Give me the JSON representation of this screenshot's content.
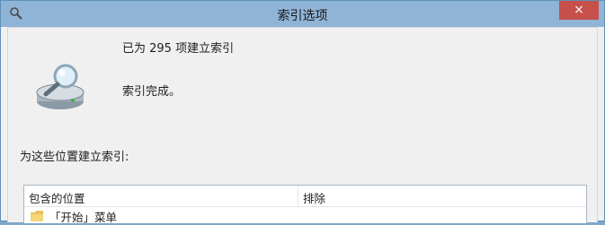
{
  "window": {
    "title": "索引选项",
    "close_label": "×"
  },
  "status": {
    "count_text": "已为 295 项建立索引",
    "done_text": "索引完成。"
  },
  "locations": {
    "section_label": "为这些位置建立索引:",
    "headers": {
      "included": "包含的位置",
      "excluded": "排除"
    },
    "rows": [
      {
        "location": "「开始」菜单",
        "excluded": ""
      }
    ]
  },
  "icons": {
    "app": "search-gear-icon",
    "status": "magnifier-drive-icon",
    "row": "folder-icon"
  },
  "colors": {
    "titlebar": "#8fb4d6",
    "close": "#c7504a",
    "window_bg": "#f0f0f0"
  }
}
